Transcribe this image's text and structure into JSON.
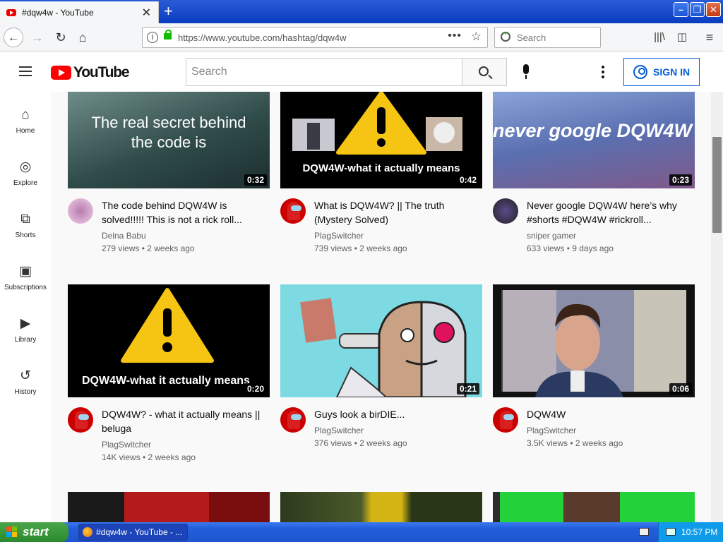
{
  "browser": {
    "tab_title": "#dqw4w - YouTube",
    "url": "https://www.youtube.com/hashtag/dqw4w",
    "search_placeholder": "Search"
  },
  "youtube": {
    "logo_text": "YouTube",
    "search_placeholder": "Search",
    "sign_in_label": "SIGN IN"
  },
  "guide": [
    {
      "label": "Home",
      "icon": "home-icon"
    },
    {
      "label": "Explore",
      "icon": "compass-icon"
    },
    {
      "label": "Shorts",
      "icon": "shorts-icon"
    },
    {
      "label": "Subscriptions",
      "icon": "subscriptions-icon"
    },
    {
      "label": "Library",
      "icon": "library-icon"
    },
    {
      "label": "History",
      "icon": "history-icon"
    }
  ],
  "videos": [
    {
      "title": "The code behind DQW4W is solved!!!!! This is not a rick roll...",
      "channel": "Delna Babu",
      "stats": "279 views • 2 weeks ago",
      "duration": "0:32",
      "thumb_text": "The real secret behind the code is"
    },
    {
      "title": "What is DQW4W? || The truth (Mystery Solved)",
      "channel": "PlagSwitcher",
      "stats": "739 views • 2 weeks ago",
      "duration": "0:42",
      "thumb_text": "DQW4W-what it actually means"
    },
    {
      "title": "Never google DQW4W here’s why #shorts #DQW4W #rickroll...",
      "channel": "sniper gamer",
      "stats": "633 views • 9 days ago",
      "duration": "0:23",
      "thumb_text": "never google DQW4W"
    },
    {
      "title": "DQW4W? - what it actually means || beluga",
      "channel": "PlagSwitcher",
      "stats": "14K views • 2 weeks ago",
      "duration": "0:20",
      "thumb_text": "DQW4W-what it actually means"
    },
    {
      "title": "Guys look a birDIE...",
      "channel": "PlagSwitcher",
      "stats": "376 views • 2 weeks ago",
      "duration": "0:21",
      "thumb_text": ""
    },
    {
      "title": "DQW4W",
      "channel": "PlagSwitcher",
      "stats": "3.5K views • 2 weeks ago",
      "duration": "0:06",
      "thumb_text": ""
    }
  ],
  "taskbar": {
    "start_label": "start",
    "task_label": "#dqw4w - YouTube - ...",
    "clock": "10:57 PM"
  }
}
